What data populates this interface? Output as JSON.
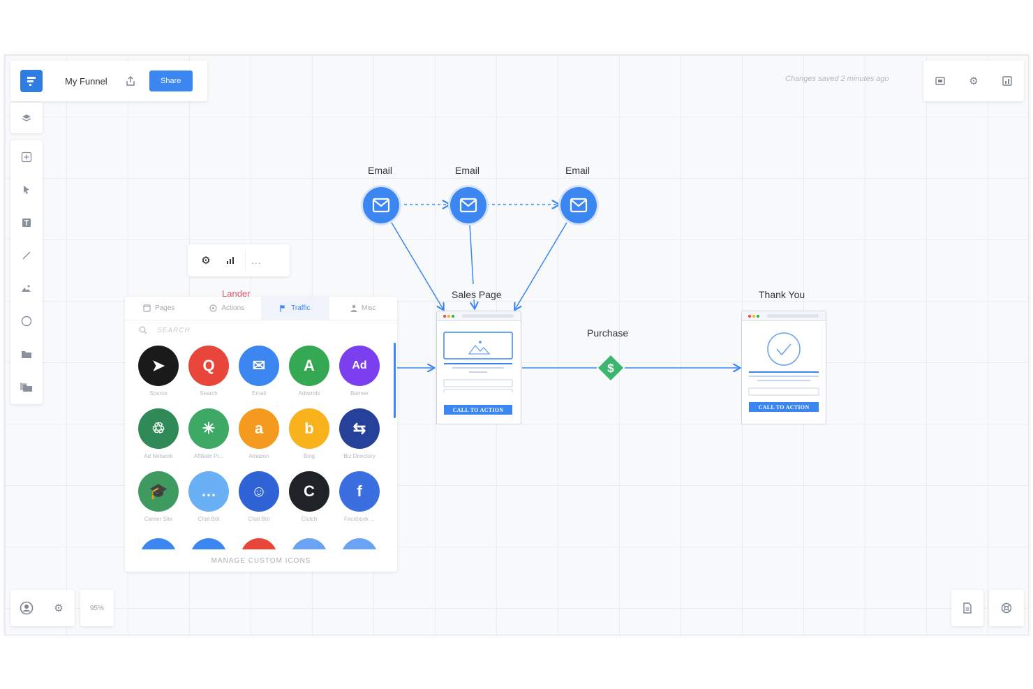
{
  "header": {
    "funnel_name": "My Funnel",
    "share_label": "Share",
    "saved_status": "Changes saved 2 minutes ago"
  },
  "zoom": {
    "level": "95%"
  },
  "node_toolbar": {
    "more_label": "..."
  },
  "lander_label": "Lander",
  "icon_panel": {
    "tabs": [
      {
        "label": "Pages",
        "icon": "page-icon"
      },
      {
        "label": "Actions",
        "icon": "actions-icon"
      },
      {
        "label": "Traffic",
        "icon": "flag-icon",
        "active": true
      },
      {
        "label": "Misc",
        "icon": "person-icon"
      }
    ],
    "search_placeholder": "SEARCH",
    "items": [
      {
        "label": "Source",
        "color": "#1a1a1a",
        "glyph": "➤"
      },
      {
        "label": "Search",
        "color": "#e8463b",
        "glyph": "Q"
      },
      {
        "label": "Email",
        "color": "#3b86f1",
        "glyph": "✉"
      },
      {
        "label": "Adwords",
        "color": "#34a853",
        "glyph": "A"
      },
      {
        "label": "Banner",
        "color": "#7b3ff0",
        "glyph": "Ad"
      },
      {
        "label": "Ad Network",
        "color": "#2f8a57",
        "glyph": "♲"
      },
      {
        "label": "Affiliate Pr...",
        "color": "#3ea865",
        "glyph": "✳"
      },
      {
        "label": "Amazon",
        "color": "#f39a1f",
        "glyph": "a"
      },
      {
        "label": "Bing",
        "color": "#f7b21c",
        "glyph": "b"
      },
      {
        "label": "Biz Directory",
        "color": "#25419a",
        "glyph": "⇆"
      },
      {
        "label": "Career Site",
        "color": "#3e9a5e",
        "glyph": "🎓"
      },
      {
        "label": "Chat Bot",
        "color": "#6ab0f5",
        "glyph": "…"
      },
      {
        "label": "Chat Bot",
        "color": "#2f63d6",
        "glyph": "☺"
      },
      {
        "label": "Clutch",
        "color": "#1f2328",
        "glyph": "C"
      },
      {
        "label": "Facebook ...",
        "color": "#3b6fe0",
        "glyph": "f"
      }
    ],
    "partial_colors": [
      "#3b86f1",
      "#3b86f1",
      "#e8463b",
      "#6aa3f3",
      "#6aa3f3"
    ],
    "manage_label": "MANAGE CUSTOM ICONS"
  },
  "flow": {
    "email_labels": [
      "Email",
      "Email",
      "Email"
    ],
    "sales_page_label": "Sales Page",
    "sales_cta": "CALL TO ACTION",
    "purchase_label": "Purchase",
    "thank_you_label": "Thank You",
    "thank_cta": "CALL TO ACTION",
    "accent": "#3b86f1",
    "purchase_color": "#3cb66e"
  }
}
